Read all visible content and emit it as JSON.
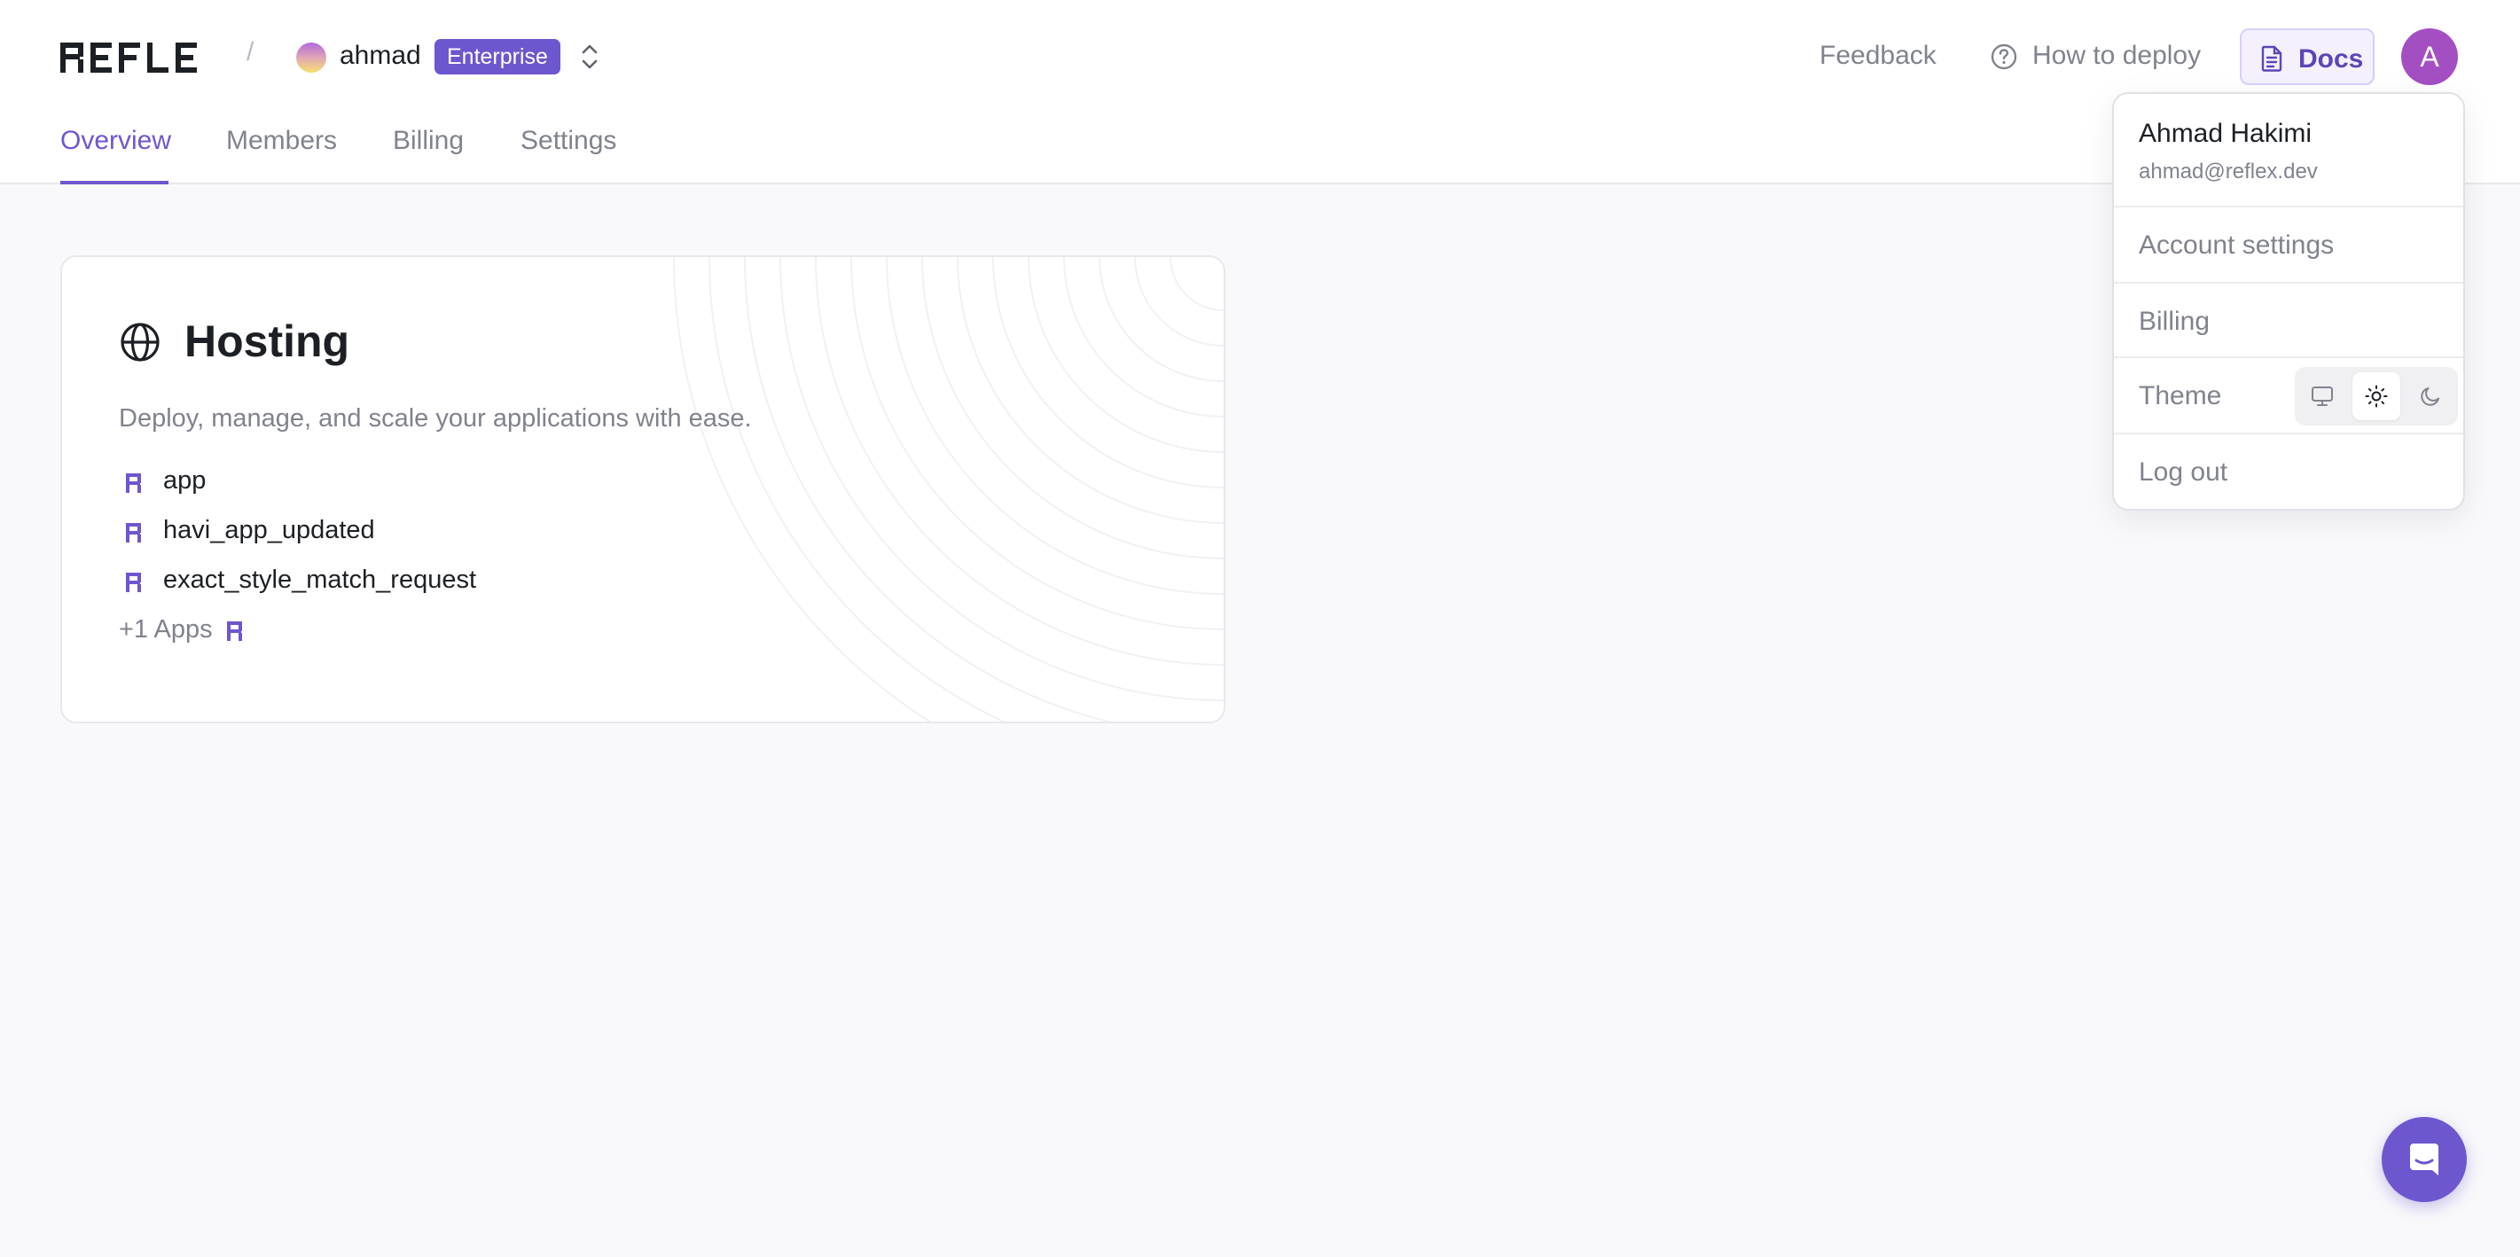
{
  "header": {
    "logo_text": "REFLEX",
    "separator": "/",
    "org_name": "ahmad",
    "plan_badge": "Enterprise",
    "links": {
      "feedback": "Feedback",
      "how_to_deploy": "How to deploy",
      "docs": "Docs"
    },
    "avatar_initial": "A"
  },
  "tabs": [
    {
      "label": "Overview",
      "active": true
    },
    {
      "label": "Members",
      "active": false
    },
    {
      "label": "Billing",
      "active": false
    },
    {
      "label": "Settings",
      "active": false
    }
  ],
  "hosting_card": {
    "icon": "globe-icon",
    "title": "Hosting",
    "description": "Deploy, manage, and scale your applications with ease.",
    "apps": [
      "app",
      "havi_app_updated",
      "exact_style_match_request"
    ],
    "more_apps": "+1 Apps"
  },
  "user_menu": {
    "name": "Ahmad Hakimi",
    "email": "ahmad@reflex.dev",
    "items": {
      "account_settings": "Account settings",
      "billing": "Billing",
      "theme": "Theme",
      "logout": "Log out"
    },
    "theme_options": [
      "system",
      "light",
      "dark"
    ],
    "theme_selected": "light"
  },
  "colors": {
    "accent": "#6e56cf",
    "avatar": "#a44fc1",
    "page_background": "#f9f9fb",
    "muted_text": "#80838d"
  }
}
